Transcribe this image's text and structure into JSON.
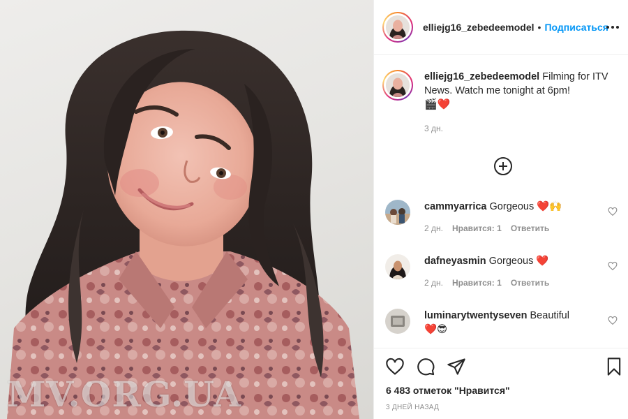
{
  "photo": {
    "alt_subject": "selfie portrait",
    "watermark": "MV.ORG.UA"
  },
  "header": {
    "username": "elliejg16_zebedeemodel",
    "dot": "•",
    "follow_label": "Подписаться",
    "more_icon": "more-horizontal-icon"
  },
  "caption": {
    "username": "elliejg16_zebedeemodel",
    "text": "Filming for ITV News. Watch me tonight at 6pm!",
    "emojis": "🎬❤️",
    "time": "3 дн."
  },
  "load_more_icon": "plus-circle-icon",
  "comments": [
    {
      "username": "cammyarrica",
      "text": "Gorgeous",
      "emojis": "❤️🙌",
      "time": "2 дн.",
      "likes": "Нравится: 1",
      "reply": "Ответить"
    },
    {
      "username": "dafneyasmin",
      "text": "Gorgeous",
      "emojis": "❤️",
      "time": "2 дн.",
      "likes": "Нравится: 1",
      "reply": "Ответить"
    },
    {
      "username": "luminarytwentyseven",
      "text": "Beautiful",
      "emojis": "❤️😎"
    }
  ],
  "actions": {
    "like_icon": "heart-icon",
    "comment_icon": "comment-icon",
    "share_icon": "send-icon",
    "save_icon": "bookmark-icon"
  },
  "likes_count": "6 483 отметок \"Нравится\"",
  "post_date": "3 ДНЕЙ НАЗАД",
  "colors": {
    "link_blue": "#0095f6",
    "secondary_text": "#8e8e8e",
    "divider": "#efefef"
  }
}
